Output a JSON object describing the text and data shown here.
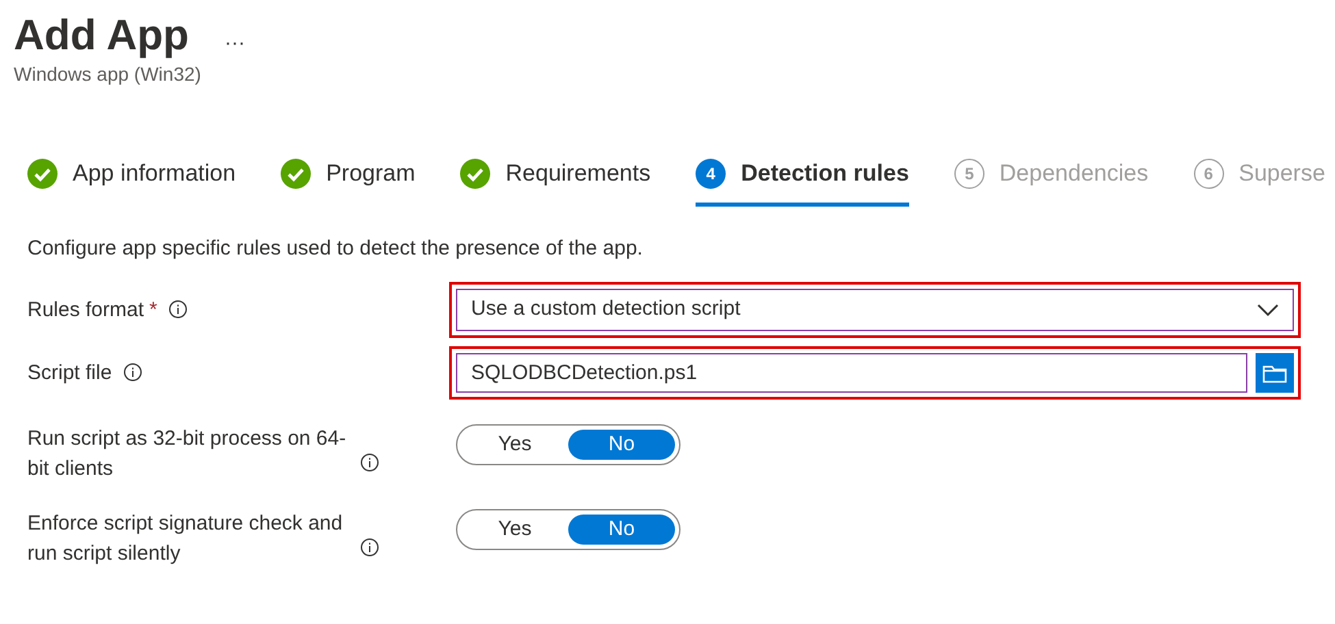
{
  "header": {
    "title": "Add App",
    "more": "···",
    "subtitle": "Windows app (Win32)"
  },
  "steps": [
    {
      "label": "App information",
      "kind": "done",
      "selected": false
    },
    {
      "label": "Program",
      "kind": "done",
      "selected": false
    },
    {
      "label": "Requirements",
      "kind": "done",
      "selected": false
    },
    {
      "number": "4",
      "label": "Detection rules",
      "kind": "current",
      "selected": true
    },
    {
      "number": "5",
      "label": "Dependencies",
      "kind": "pending",
      "selected": false
    },
    {
      "number": "6",
      "label": "Superse",
      "kind": "pending",
      "selected": false
    }
  ],
  "description": "Configure app specific rules used to detect the presence of the app.",
  "fields": [
    {
      "kind": "select",
      "label": "Rules format",
      "required": true,
      "required_mark": "*",
      "value": "Use a custom detection script",
      "highlighted": true
    },
    {
      "kind": "file",
      "label": "Script file",
      "value": "SQLODBCDetection.ps1",
      "highlighted": true
    },
    {
      "kind": "toggle",
      "label": "Run script as 32-bit process on 64-bit clients",
      "options": [
        {
          "label": "Yes",
          "selected": false
        },
        {
          "label": "No",
          "selected": true
        }
      ]
    },
    {
      "kind": "toggle",
      "label": "Enforce script signature check and run script silently",
      "options": [
        {
          "label": "Yes",
          "selected": false
        },
        {
          "label": "No",
          "selected": true
        }
      ]
    }
  ]
}
